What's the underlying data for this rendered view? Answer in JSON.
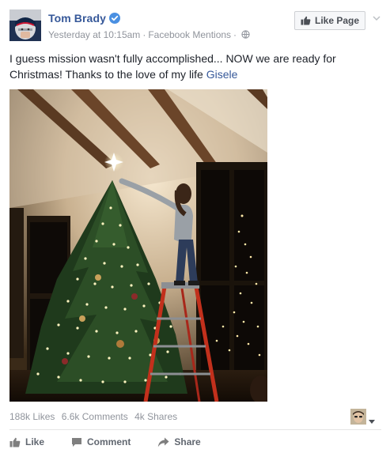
{
  "post": {
    "author_name": "Tom Brady",
    "timestamp": "Yesterday at 10:15am",
    "separator": "·",
    "source": "Facebook Mentions",
    "text_main": "I guess mission wasn't fully accomplished... NOW we are ready for Christmas! Thanks to the love of my life ",
    "text_mention": "Gisele"
  },
  "header": {
    "like_page_label": "Like Page"
  },
  "stats": {
    "likes": "188k Likes",
    "comments": "6.6k Comments",
    "shares": "4k Shares"
  },
  "actions": {
    "like": "Like",
    "comment": "Comment",
    "share": "Share"
  },
  "colors": {
    "link_blue": "#365899",
    "meta_gray": "#90949c",
    "action_gray": "#616770",
    "verified_blue": "#4a90e2"
  },
  "icons": [
    "verified-badge-icon",
    "globe-icon",
    "thumbs-up-icon",
    "chevron-down-icon",
    "comment-icon",
    "share-icon",
    "caret-down-icon"
  ]
}
